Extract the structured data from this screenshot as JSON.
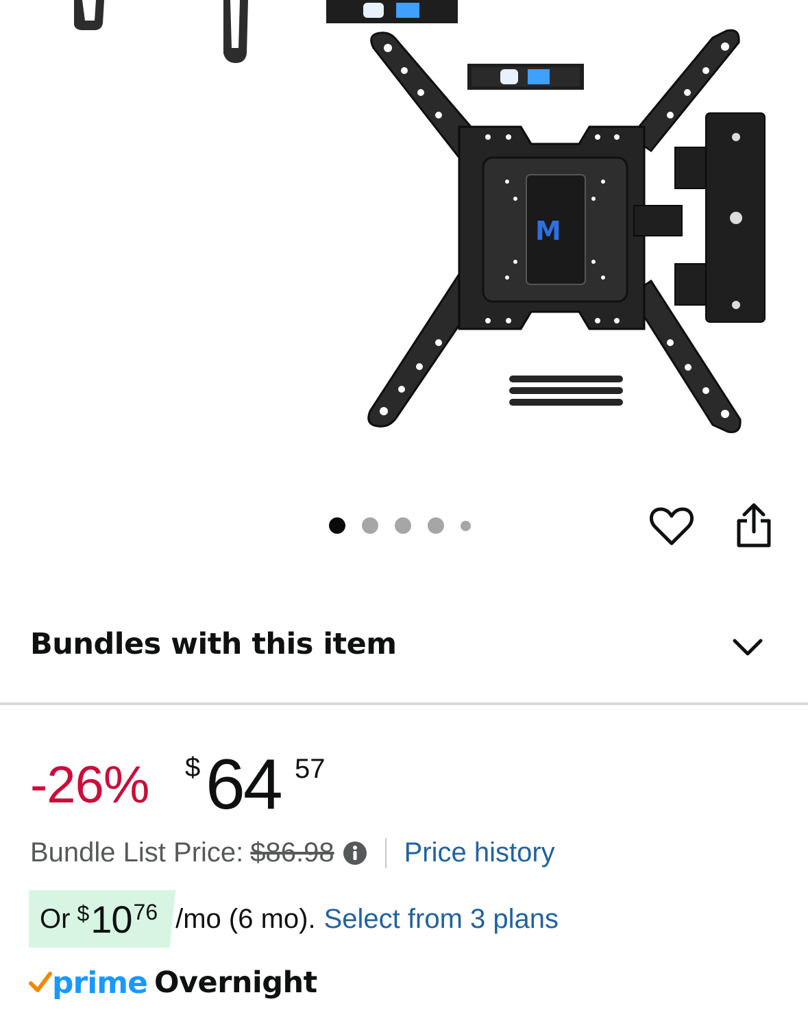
{
  "gallery": {
    "image_alt": "Full motion TV wall mount with leveler, articulating arm and spacers",
    "dot_count": 5,
    "active_dot": 0
  },
  "actions": {
    "wishlist_icon": "heart-icon",
    "share_icon": "share-icon"
  },
  "bundles": {
    "title": "Bundles with this item",
    "toggle_icon": "chevron-down-icon"
  },
  "price": {
    "discount": "-26%",
    "currency_symbol": "$",
    "whole": "64",
    "fraction": "57",
    "list_label": "Bundle List Price:",
    "list_price": "$86.98",
    "info_icon": "info-icon",
    "history_link": "Price history"
  },
  "installments": {
    "prefix": "Or",
    "currency_symbol": "$",
    "whole": "10",
    "fraction": "76",
    "suffix": "/mo (6 mo).",
    "link": "Select from 3 plans"
  },
  "delivery": {
    "prime_label": "prime",
    "speed": "Overnight"
  },
  "colors": {
    "discount": "#cc0c39",
    "link": "#2162a1",
    "prime": "#1a98ff",
    "badge_bg": "#d8f5e4"
  }
}
